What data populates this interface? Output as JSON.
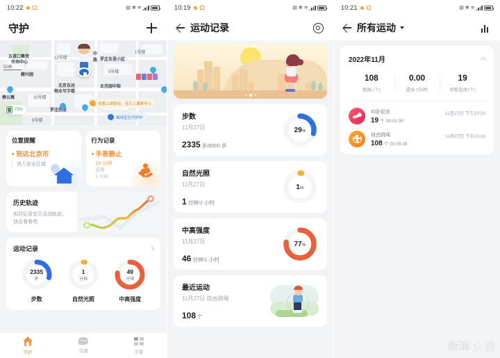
{
  "panel1": {
    "status": {
      "time": "10:22"
    },
    "appbar": {
      "title": "守护",
      "add_icon": "plus-icon"
    },
    "map": {
      "scale": "50米",
      "battery": "73%",
      "labels": [
        "五道口集贸",
        "市场中心",
        "12号楼",
        "中",
        "路",
        "1号楼",
        "罗庄东里小区",
        "5号楼",
        "碧兴园",
        "北京东达",
        "物业写字楼",
        "太月园中街",
        "春公寓",
        "10号楼",
        "罗庄西里",
        "9号楼"
      ],
      "tip1": "设置上课禁用，宝贝上课更专心",
      "tip2": "离线定位守护中"
    },
    "location_card": {
      "title": "位置提醒",
      "main": "到达北京市",
      "sub": "进入安全区域"
    },
    "behavior_card": {
      "title": "行为记录",
      "main": "手表静止",
      "sub": "24 分钟",
      "extra_label": "走路",
      "extra_value": "6 分钟"
    },
    "history_card": {
      "title": "历史轨迹",
      "desc_line1": "实时记录宝贝活动轨迹，",
      "desc_line2": "快去看看吧"
    },
    "sport_card": {
      "title": "运动记录",
      "rings": [
        {
          "num": "2335",
          "unit": "步",
          "caption": "步数",
          "percent": 29,
          "color": "#2f6fe0"
        },
        {
          "num": "1",
          "unit": "分钟",
          "caption": "自然光照",
          "percent": 1,
          "color": "#f0b02e"
        },
        {
          "num": "49",
          "unit": "分钟",
          "caption": "中高强度",
          "percent": 77,
          "color": "#e8603c"
        }
      ]
    },
    "bottom_nav": [
      {
        "label": "守护",
        "icon": "home-icon",
        "active": true
      },
      {
        "label": "沟通",
        "icon": "chat-icon",
        "active": false
      },
      {
        "label": "设备",
        "icon": "device-icon",
        "active": false
      }
    ]
  },
  "panel2": {
    "status": {
      "time": "10:19"
    },
    "appbar": {
      "title": "运动记录",
      "back_icon": "back-arrow-icon",
      "settings_icon": "gear-icon"
    },
    "cards": [
      {
        "title": "步数",
        "date": "11月27日",
        "value": "2335",
        "value_unit": "步/8000 步",
        "percent_text": "29",
        "percent": 29,
        "color": "#2f6fe0"
      },
      {
        "title": "自然光照",
        "date": "11月27日",
        "value": "1",
        "value_unit": "分钟/2 小时",
        "percent_text": "1",
        "percent": 1,
        "color": "#f0b02e"
      },
      {
        "title": "中高强度",
        "date": "11月27日",
        "value": "46",
        "value_unit": "分钟/1 小时",
        "percent_text": "77",
        "percent": 77,
        "color": "#e8603c"
      }
    ],
    "recent": {
      "title": "最近运动",
      "date": "11月27日 自由跳绳",
      "value": "108",
      "value_unit": "个"
    }
  },
  "panel3": {
    "status": {
      "time": "10:21"
    },
    "appbar": {
      "title": "所有运动",
      "back_icon": "back-arrow-icon",
      "dropdown_icon": "chevron-down-icon",
      "chart_icon": "bar-chart-icon"
    },
    "month_card": {
      "month": "2022年11月",
      "collapse_icon": "chevron-up-icon",
      "stats": [
        {
          "value": "108",
          "label": "跳绳 (个)"
        },
        {
          "value": "0.00",
          "label": "游泳 (分钟)"
        },
        {
          "value": "19",
          "label": "仰卧起坐(个)"
        }
      ],
      "entries": [
        {
          "name": "仰卧起坐",
          "value": "19",
          "unit": "个",
          "duration": "00:01:00",
          "date": "11月27日 下午10:20",
          "icon": "situp-icon",
          "color": "#ef3f5b"
        },
        {
          "name": "自由跳绳",
          "value": "108",
          "unit": "个",
          "duration": "00:00:39",
          "date": "11月27日 下午10:18",
          "icon": "jumprope-icon",
          "color": "#f7921e"
        }
      ]
    },
    "watermark": {
      "left": "新浪",
      "right": "众测"
    }
  }
}
